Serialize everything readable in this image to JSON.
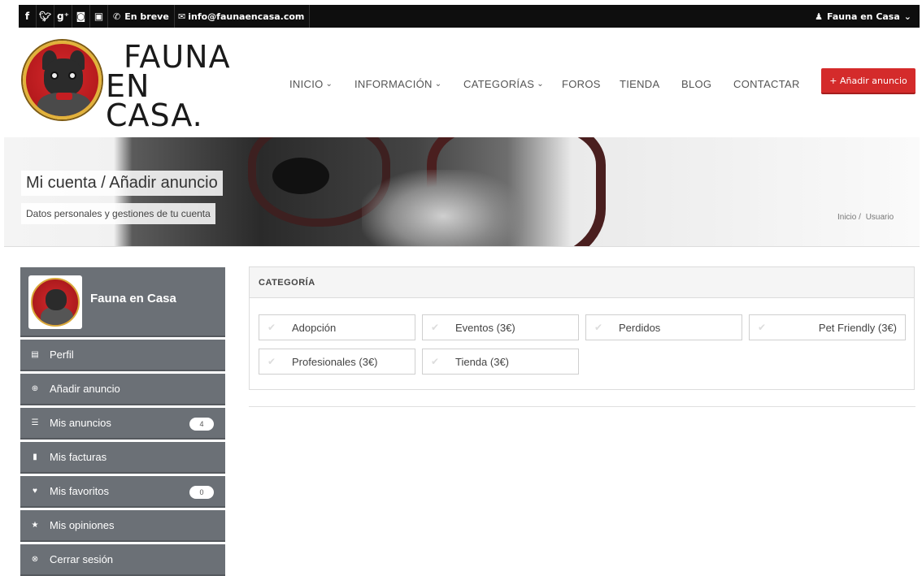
{
  "topbar": {
    "social_icons": [
      "facebook-icon",
      "twitter-icon",
      "google-plus-icon",
      "instagram-icon",
      "youtube-icon"
    ],
    "phone_label": "En breve",
    "email_label": "info@faunaencasa.com",
    "user_label": "Fauna en Casa"
  },
  "header": {
    "logo_line1": "FAUNA",
    "logo_line2": "EN CASA.",
    "nav": [
      {
        "label": "INICIO",
        "dropdown": true
      },
      {
        "label": "INFORMACIÓN",
        "dropdown": true
      },
      {
        "label": "CATEGORÍAS",
        "dropdown": true
      },
      {
        "label": "FOROS",
        "dropdown": false
      },
      {
        "label": "TIENDA",
        "dropdown": false
      },
      {
        "label": "BLOG",
        "dropdown": false
      },
      {
        "label": "CONTACTAR",
        "dropdown": false
      }
    ],
    "add_button": "+ Añadir anuncio",
    "brand_color": "#d42b2b"
  },
  "banner": {
    "title": "Mi cuenta / Añadir anuncio",
    "subtitle": "Datos personales y gestiones de tu cuenta",
    "breadcrumb": [
      "Inicio /",
      "Usuario"
    ]
  },
  "sidebar": {
    "profile_name": "Fauna en Casa",
    "items": [
      {
        "label": "Perfil",
        "icon": "profile-icon"
      },
      {
        "label": "Añadir anuncio",
        "icon": "plus-circle-icon"
      },
      {
        "label": "Mis anuncios",
        "icon": "list-icon",
        "badge": "4"
      },
      {
        "label": "Mis facturas",
        "icon": "invoice-icon"
      },
      {
        "label": "Mis favoritos",
        "icon": "heart-icon",
        "badge": "0"
      },
      {
        "label": "Mis opiniones",
        "icon": "star-icon"
      },
      {
        "label": "Cerrar sesión",
        "icon": "close-circle-icon"
      }
    ],
    "color": "#6b7076"
  },
  "categories": {
    "header": "CATEGORÍA",
    "options": [
      "Adopción",
      "Eventos (3€)",
      "Perdidos",
      "Pet Friendly (3€)",
      "Profesionales (3€)",
      "Tienda (3€)"
    ]
  }
}
